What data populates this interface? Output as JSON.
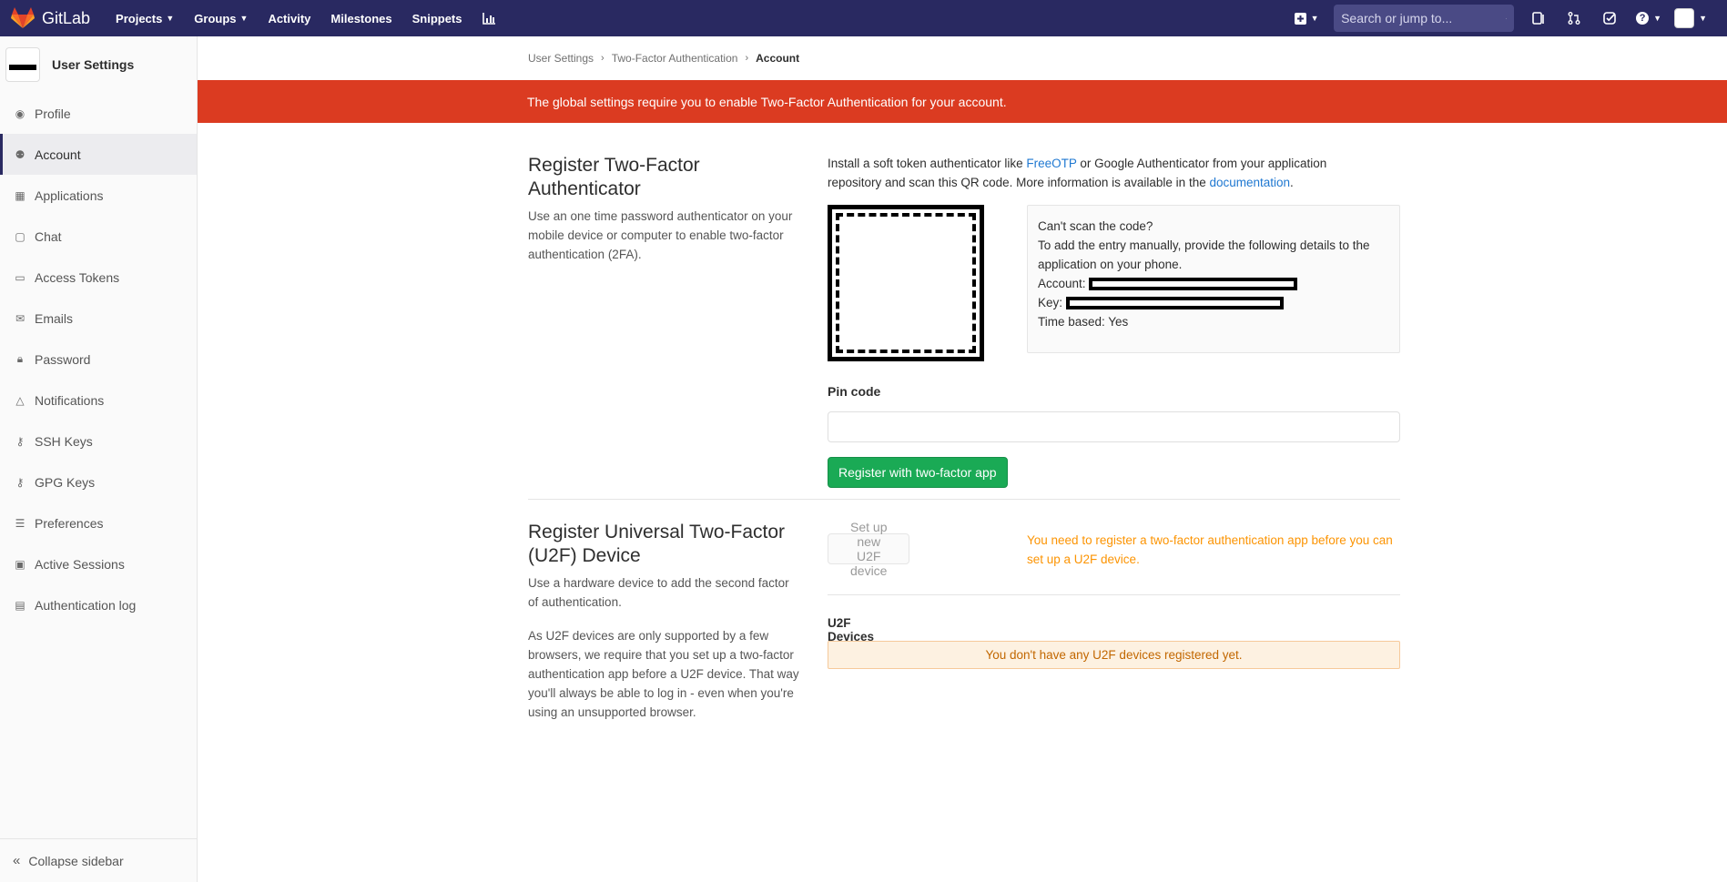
{
  "navbar": {
    "brand": "GitLab",
    "links": [
      {
        "label": "Projects",
        "dropdown": true
      },
      {
        "label": "Groups",
        "dropdown": true
      },
      {
        "label": "Activity",
        "dropdown": false
      },
      {
        "label": "Milestones",
        "dropdown": false
      },
      {
        "label": "Snippets",
        "dropdown": false
      }
    ],
    "search_placeholder": "Search or jump to...",
    "colors": {
      "bg": "#292961",
      "search_bg": "#4a4a85"
    }
  },
  "sidebar": {
    "title": "User Settings",
    "items": [
      {
        "label": "Profile",
        "icon": "profile-icon"
      },
      {
        "label": "Account",
        "icon": "account-icon",
        "active": true
      },
      {
        "label": "Applications",
        "icon": "applications-icon"
      },
      {
        "label": "Chat",
        "icon": "chat-icon"
      },
      {
        "label": "Access Tokens",
        "icon": "token-icon"
      },
      {
        "label": "Emails",
        "icon": "mail-icon"
      },
      {
        "label": "Password",
        "icon": "lock-icon"
      },
      {
        "label": "Notifications",
        "icon": "bell-icon"
      },
      {
        "label": "SSH Keys",
        "icon": "key-icon"
      },
      {
        "label": "GPG Keys",
        "icon": "key-icon"
      },
      {
        "label": "Preferences",
        "icon": "sliders-icon"
      },
      {
        "label": "Active Sessions",
        "icon": "monitor-icon"
      },
      {
        "label": "Authentication log",
        "icon": "log-icon"
      }
    ],
    "collapse_label": "Collapse sidebar"
  },
  "breadcrumb": [
    "User Settings",
    "Two-Factor Authentication",
    "Account"
  ],
  "alert": {
    "text": "The global settings require you to enable Two-Factor Authentication for your account.",
    "color": "#db3b21"
  },
  "totp": {
    "title": "Register Two-Factor Authenticator",
    "description": "Use an one time password authenticator on your mobile device or computer to enable two-factor authentication (2FA).",
    "install_prefix": "Install a soft token authenticator like ",
    "freeotp_link": "FreeOTP",
    "install_middle": " or Google Authenticator from your application repository and scan this QR code. More information is available in the ",
    "documentation_link": "documentation",
    "install_suffix": ".",
    "manual": {
      "cant_scan": "Can't scan the code?",
      "instructions": "To add the entry manually, provide the following details to the application on your phone.",
      "account_label": "Account:",
      "key_label": "Key:",
      "time_based": "Time based: Yes"
    },
    "pin_label": "Pin code",
    "register_button": "Register with two-factor app"
  },
  "u2f": {
    "title": "Register Universal Two-Factor (U2F) Device",
    "description1": "Use a hardware device to add the second factor of authentication.",
    "description2": "As U2F devices are only supported by a few browsers, we require that you set up a two-factor authentication app before a U2F device. That way you'll always be able to log in - even when you're using an unsupported browser.",
    "setup_button": "Set up new U2F device",
    "warning": "You need to register a two-factor authentication app before you can set up a U2F device.",
    "devices_title": "U2F Devices (0)",
    "empty_message": "You don't have any U2F devices registered yet."
  }
}
